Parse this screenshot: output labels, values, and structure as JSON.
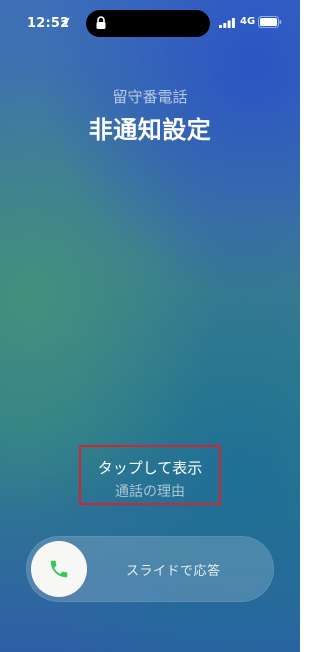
{
  "status_bar": {
    "time": "12:52",
    "network": "4G"
  },
  "call": {
    "subtitle": "留守番電話",
    "caller": "非通知設定",
    "tap_to_show": "タップして表示",
    "reason": "通話の理由"
  },
  "slider": {
    "label": "スライドで応答"
  },
  "colors": {
    "highlight_box": "#d3252b",
    "answer_green": "#34c759"
  },
  "icons": {
    "location": "location-arrow-icon",
    "lock": "lock-icon",
    "signal": "cellular-signal-icon",
    "battery": "battery-icon",
    "phone": "phone-handset-icon"
  }
}
